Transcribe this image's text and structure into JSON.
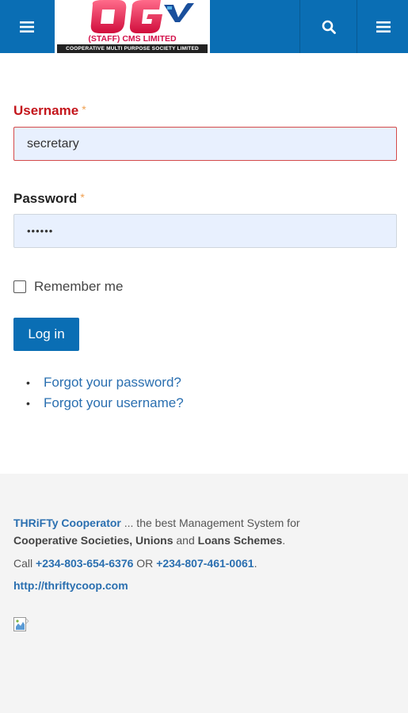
{
  "header": {
    "logo_subtitle": "(STAFF) CMS LIMITED",
    "logo_strip": "COOPERATIVE MULTI PURPOSE SOCIETY LIMITED",
    "left_icon": "hamburger-icon",
    "search_icon": "search-icon",
    "menu_icon": "hamburger-icon",
    "color": "#0a6eb4"
  },
  "form": {
    "username_label": "Username",
    "username_value": "secretary",
    "password_label": "Password",
    "password_value": "••••••",
    "required_marker": "*",
    "remember_label": "Remember me",
    "remember_checked": false,
    "login_label": "Log in",
    "links": [
      "Forgot your password?",
      "Forgot your username?"
    ]
  },
  "footer": {
    "brand": "THRiFTy Cooperator",
    "tagline_rest": " ... the best Management System for",
    "line2_a": "Cooperative Societies, Unions",
    "line2_b": " and ",
    "line2_c": "Loans Schemes",
    "line2_d": ".",
    "call_prefix": "Call ",
    "phone1": "+234-803-654-6376",
    "or": " OR ",
    "phone2": "+234-807-461-0061",
    "dot": ".",
    "url": "http://thriftycoop.com"
  }
}
